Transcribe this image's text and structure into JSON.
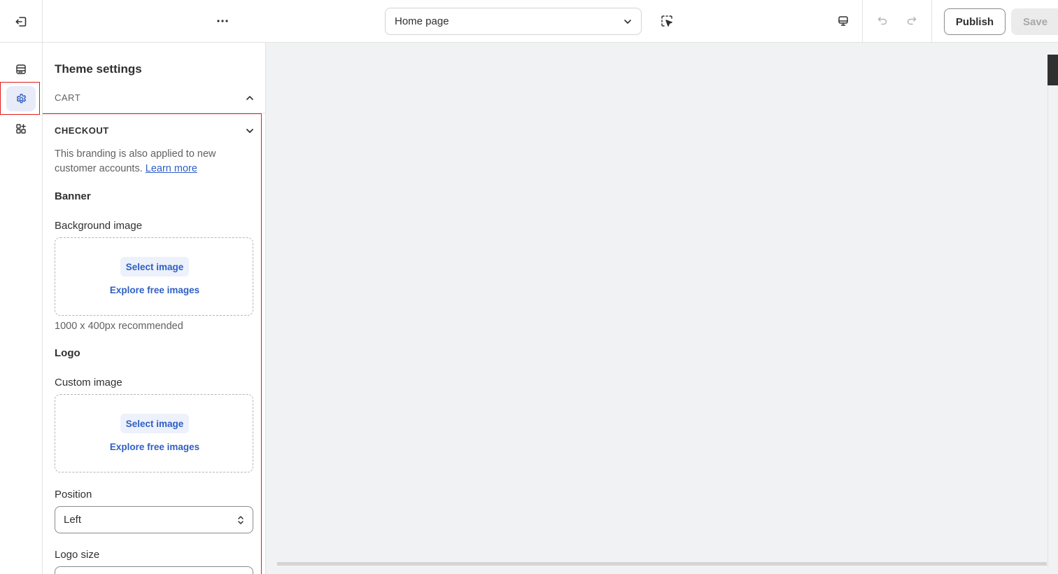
{
  "topbar": {
    "page_select_label": "Home page",
    "publish_label": "Publish",
    "save_label": "Save"
  },
  "panel": {
    "title": "Theme settings",
    "cart_label": "CART",
    "checkout_label": "CHECKOUT",
    "helptext": "This branding is also applied to new customer accounts.",
    "learn_more": "Learn more",
    "banner": {
      "heading": "Banner",
      "bg_label": "Background image",
      "select_image": "Select image",
      "explore": "Explore free images",
      "hint": "1000 x 400px recommended"
    },
    "logo": {
      "heading": "Logo",
      "custom_label": "Custom image",
      "select_image": "Select image",
      "explore": "Explore free images"
    },
    "position": {
      "label": "Position",
      "value": "Left"
    },
    "logo_size": {
      "label": "Logo size"
    }
  },
  "colors": {
    "accent": "#2f5fc4",
    "highlight_box": "#e01e1e",
    "preview_bg": "#f1f2f4"
  }
}
